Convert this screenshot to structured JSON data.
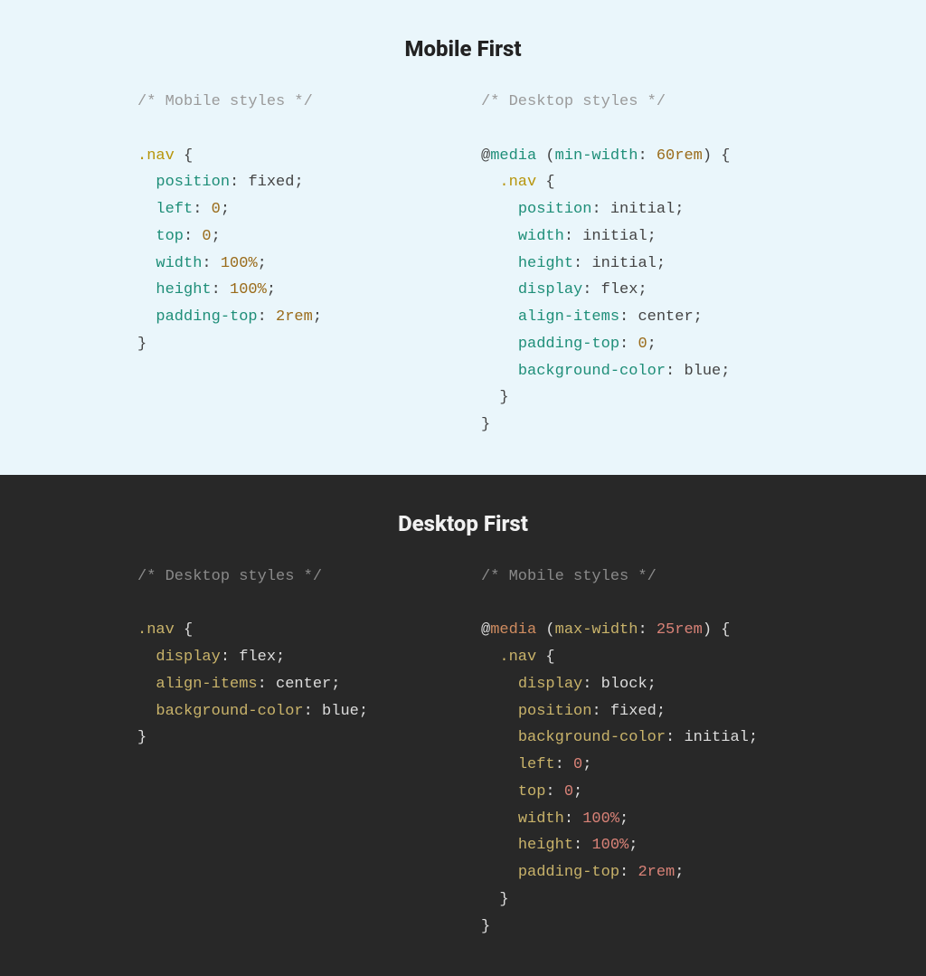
{
  "sections": [
    {
      "id": "mobile-first",
      "theme": "light",
      "title": "Mobile First",
      "columns": [
        {
          "id": "mf-left",
          "comment": "/* Mobile styles */",
          "code": [
            {
              "t": "sel-open",
              "selector": ".nav"
            },
            {
              "t": "decl",
              "prop": "position",
              "value": "fixed"
            },
            {
              "t": "decl",
              "prop": "left",
              "number": "0"
            },
            {
              "t": "decl",
              "prop": "top",
              "number": "0"
            },
            {
              "t": "decl",
              "prop": "width",
              "number": "100",
              "unit": "%"
            },
            {
              "t": "decl",
              "prop": "height",
              "number": "100",
              "unit": "%"
            },
            {
              "t": "decl",
              "prop": "padding-top",
              "number": "2",
              "unit": "rem"
            },
            {
              "t": "close"
            }
          ]
        },
        {
          "id": "mf-right",
          "comment": "/* Desktop styles */",
          "code": [
            {
              "t": "media-open",
              "keyword": "media",
              "query_prop": "min-width",
              "query_num": "60",
              "query_unit": "rem"
            },
            {
              "t": "sel-open",
              "selector": ".nav",
              "indent": 1
            },
            {
              "t": "decl",
              "prop": "position",
              "value": "initial",
              "indent": 1
            },
            {
              "t": "decl",
              "prop": "width",
              "value": "initial",
              "indent": 1
            },
            {
              "t": "decl",
              "prop": "height",
              "value": "initial",
              "indent": 1
            },
            {
              "t": "decl",
              "prop": "display",
              "value": "flex",
              "indent": 1
            },
            {
              "t": "decl",
              "prop": "align-items",
              "value": "center",
              "indent": 1
            },
            {
              "t": "decl",
              "prop": "padding-top",
              "number": "0",
              "indent": 1
            },
            {
              "t": "decl",
              "prop": "background-color",
              "value": "blue",
              "indent": 1
            },
            {
              "t": "close",
              "indent": 1
            },
            {
              "t": "close"
            }
          ]
        }
      ]
    },
    {
      "id": "desktop-first",
      "theme": "dark",
      "title": "Desktop First",
      "columns": [
        {
          "id": "df-left",
          "comment": "/* Desktop styles */",
          "code": [
            {
              "t": "sel-open",
              "selector": ".nav"
            },
            {
              "t": "decl",
              "prop": "display",
              "value": "flex"
            },
            {
              "t": "decl",
              "prop": "align-items",
              "value": "center"
            },
            {
              "t": "decl",
              "prop": "background-color",
              "value": "blue"
            },
            {
              "t": "close"
            }
          ]
        },
        {
          "id": "df-right",
          "comment": "/* Mobile styles */",
          "code": [
            {
              "t": "media-open",
              "keyword": "media",
              "query_prop": "max-width",
              "query_num": "25",
              "query_unit": "rem"
            },
            {
              "t": "sel-open",
              "selector": ".nav",
              "indent": 1
            },
            {
              "t": "decl",
              "prop": "display",
              "value": "block",
              "indent": 1
            },
            {
              "t": "decl",
              "prop": "position",
              "value": "fixed",
              "indent": 1
            },
            {
              "t": "decl",
              "prop": "background-color",
              "value": "initial",
              "indent": 1
            },
            {
              "t": "decl",
              "prop": "left",
              "number": "0",
              "indent": 1
            },
            {
              "t": "decl",
              "prop": "top",
              "number": "0",
              "indent": 1
            },
            {
              "t": "decl",
              "prop": "width",
              "number": "100",
              "unit": "%",
              "indent": 1
            },
            {
              "t": "decl",
              "prop": "height",
              "number": "100",
              "unit": "%",
              "indent": 1
            },
            {
              "t": "decl",
              "prop": "padding-top",
              "number": "2",
              "unit": "rem",
              "indent": 1
            },
            {
              "t": "close",
              "indent": 1
            },
            {
              "t": "close"
            }
          ]
        }
      ]
    }
  ]
}
